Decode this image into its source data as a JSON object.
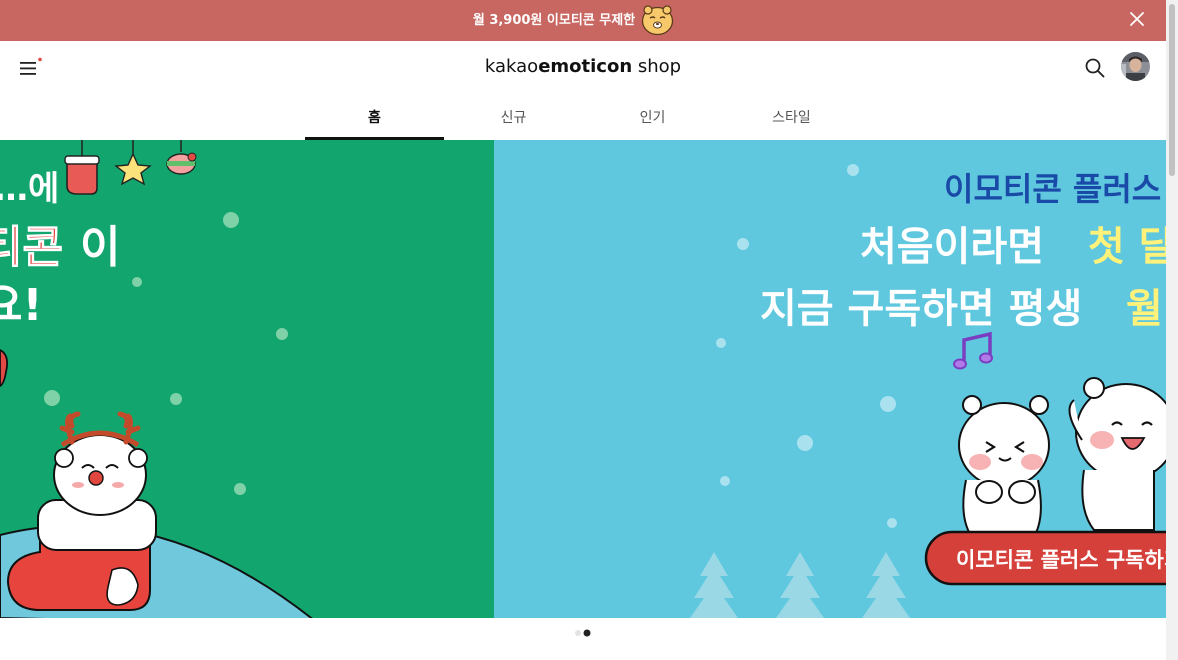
{
  "promo": {
    "text": "월 3,900원 이모티콘 무제한",
    "emoji_icon": "bear-face-icon",
    "close_icon": "close-icon"
  },
  "header": {
    "brand_bold": "emoticon",
    "brand_prefix": "kakao",
    "brand_suffix": " shop",
    "menu_icon": "hamburger-menu-icon",
    "search_icon": "search-icon",
    "avatar": "user-avatar"
  },
  "tabs": [
    {
      "label": "홈",
      "active": true
    },
    {
      "label": "신규",
      "active": false
    },
    {
      "label": "인기",
      "active": false
    },
    {
      "label": "스타일",
      "active": false
    }
  ],
  "carousel": {
    "slide_green": {
      "line1": "…에",
      "line2_red": "티콘",
      "line2_white": "이",
      "line3": "요!"
    },
    "slide_blue": {
      "title": "이모티콘 플러스",
      "line2_white": "처음이라면 ",
      "line2_yellow": "첫 달",
      "line3_white": "지금 구독하면 평생 ",
      "line3_yellow": "월",
      "cta": "이모티콘 플러스 구독하기"
    },
    "active_index": 1,
    "total_slides": 2
  },
  "colors": {
    "promo_bg": "#c86661",
    "green_slide": "#12a66e",
    "blue_slide": "#5fc8df",
    "title_blue": "#1a4aa8",
    "yellow_text": "#fff27a",
    "cta_red": "#d5403b"
  }
}
